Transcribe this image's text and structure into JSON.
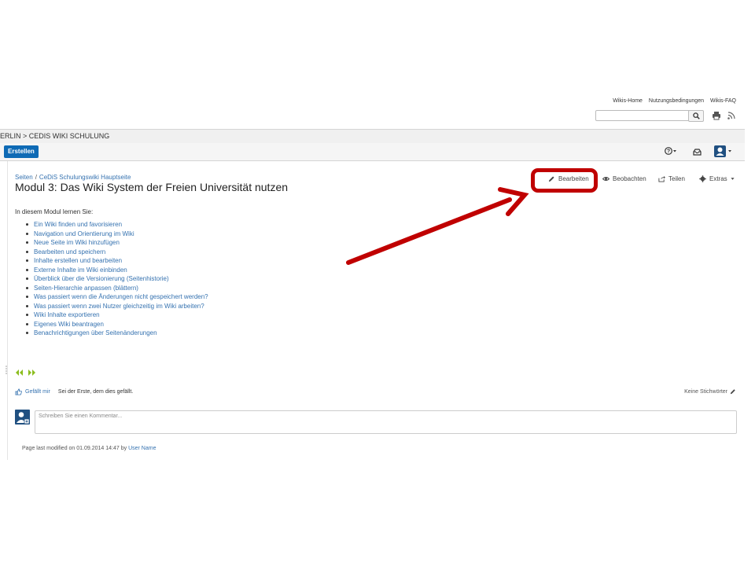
{
  "header": {
    "links": [
      "Wikis-Home",
      "Nutzungsbedingungen",
      "Wikis-FAQ"
    ],
    "search": {
      "value": "",
      "placeholder": ""
    }
  },
  "breadcrumb_bar": {
    "text": "ERLIN > CEDIS WIKI SCHULUNG"
  },
  "toolbar": {
    "create_label": "Erstellen",
    "help_icon": "help-icon",
    "notification_icon": "inbox-icon",
    "user_icon": "user-avatar-icon"
  },
  "page": {
    "breadcrumbs": [
      "Seiten",
      "CeDiS Schulungswiki Hauptseite"
    ],
    "title": "Modul 3: Das Wiki System der Freien Universität nutzen",
    "actions": {
      "edit": "Bearbeiten",
      "watch": "Beobachten",
      "share": "Teilen",
      "tools": "Extras"
    },
    "intro": "In diesem Modul lernen Sie:",
    "items": [
      "Ein Wiki finden und favorisieren",
      "Navigation und Orientierung im Wiki",
      "Neue Seite im Wiki hinzufügen",
      "Bearbeiten und speichern",
      "Inhalte erstellen und bearbeiten",
      "Externe Inhalte im Wiki einbinden",
      "Überblick über die Versionierung (Seitenhistorie)",
      "Seiten-Hierarchie anpassen (blättern)",
      "Was passiert wenn die Änderungen nicht gespeichert werden?",
      "Was passiert wenn zwei Nutzer gleichzeitig im Wiki arbeiten?",
      "Wiki Inhalte exportieren",
      "Eigenes Wiki beantragen",
      "Benachrichtigungen über Seitenänderungen"
    ],
    "like": {
      "label": "Gefällt mir",
      "text": "Sei der Erste, dem dies gefällt."
    },
    "labels_text": "Keine Stichwörter",
    "comment_placeholder": "Schreiben Sie einen Kommentar...",
    "footer": {
      "prefix": "Page last modified on 01.09.2014 14:47 by",
      "user": "User Name"
    }
  },
  "colors": {
    "link": "#3572b0",
    "create_button": "#0e6ab5",
    "highlight": "#c00000",
    "nav_arrows": "#8bbd1e"
  }
}
